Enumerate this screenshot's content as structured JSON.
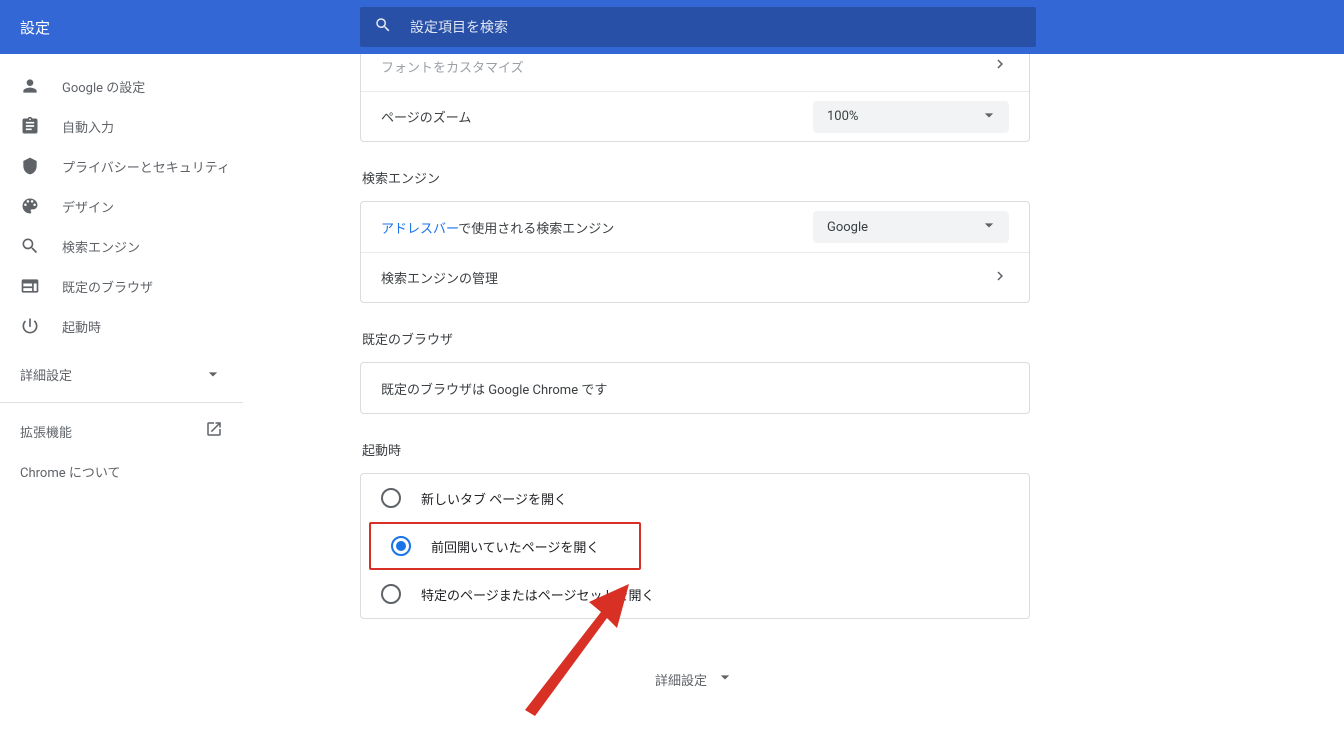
{
  "header": {
    "title": "設定",
    "search_placeholder": "設定項目を検索"
  },
  "sidebar": {
    "items": [
      {
        "label": "Google の設定"
      },
      {
        "label": "自動入力"
      },
      {
        "label": "プライバシーとセキュリティ"
      },
      {
        "label": "デザイン"
      },
      {
        "label": "検索エンジン"
      },
      {
        "label": "既定のブラウザ"
      },
      {
        "label": "起動時"
      }
    ],
    "advanced": "詳細設定",
    "extensions": "拡張機能",
    "about": "Chrome について"
  },
  "appearance": {
    "customize_fonts": "フォントをカスタマイズ",
    "page_zoom_label": "ページのズーム",
    "page_zoom_value": "100%"
  },
  "search_engine": {
    "section_title": "検索エンジン",
    "address_bar_link": "アドレスバー",
    "address_bar_rest": "で使用される検索エンジン",
    "selected": "Google",
    "manage": "検索エンジンの管理"
  },
  "default_browser": {
    "section_title": "既定のブラウザ",
    "status": "既定のブラウザは Google Chrome です"
  },
  "on_startup": {
    "section_title": "起動時",
    "options": [
      "新しいタブ ページを開く",
      "前回開いていたページを開く",
      "特定のページまたはページセットを開く"
    ],
    "selected_index": 1
  },
  "footer": {
    "advanced": "詳細設定"
  }
}
